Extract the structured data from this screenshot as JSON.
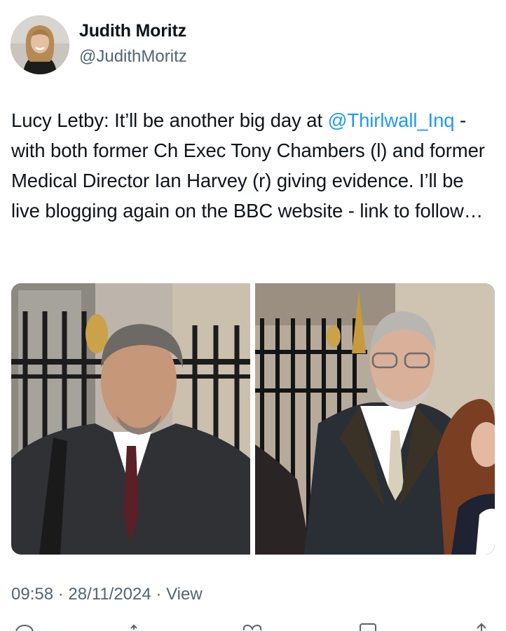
{
  "author": {
    "display_name": "Judith Moritz",
    "handle": "@JudithMoritz"
  },
  "tweet": {
    "text_before": "Lucy Letby: It’ll be another big day at ",
    "mention": "@Thirlwall_Inq",
    "text_after": " - with both former Ch Exec Tony Chambers (l) and former Medical Director Ian Harvey (r) giving evidence. I’ll be live blogging again on the BBC website - link to follow…"
  },
  "media": {
    "left_photo": "man-in-dark-coat-burgundy-tie",
    "right_photo": "man-with-glasses-dark-jacket"
  },
  "meta": {
    "time": "09:58",
    "separator": " · ",
    "date": "28/11/2024",
    "views_label": "View"
  },
  "actions": {
    "icons": [
      "reply-icon",
      "retweet-icon",
      "like-icon",
      "bookmark-icon",
      "share-icon"
    ]
  },
  "colors": {
    "text": "#0f1419",
    "secondary": "#536471",
    "link": "#1d9bf0"
  }
}
